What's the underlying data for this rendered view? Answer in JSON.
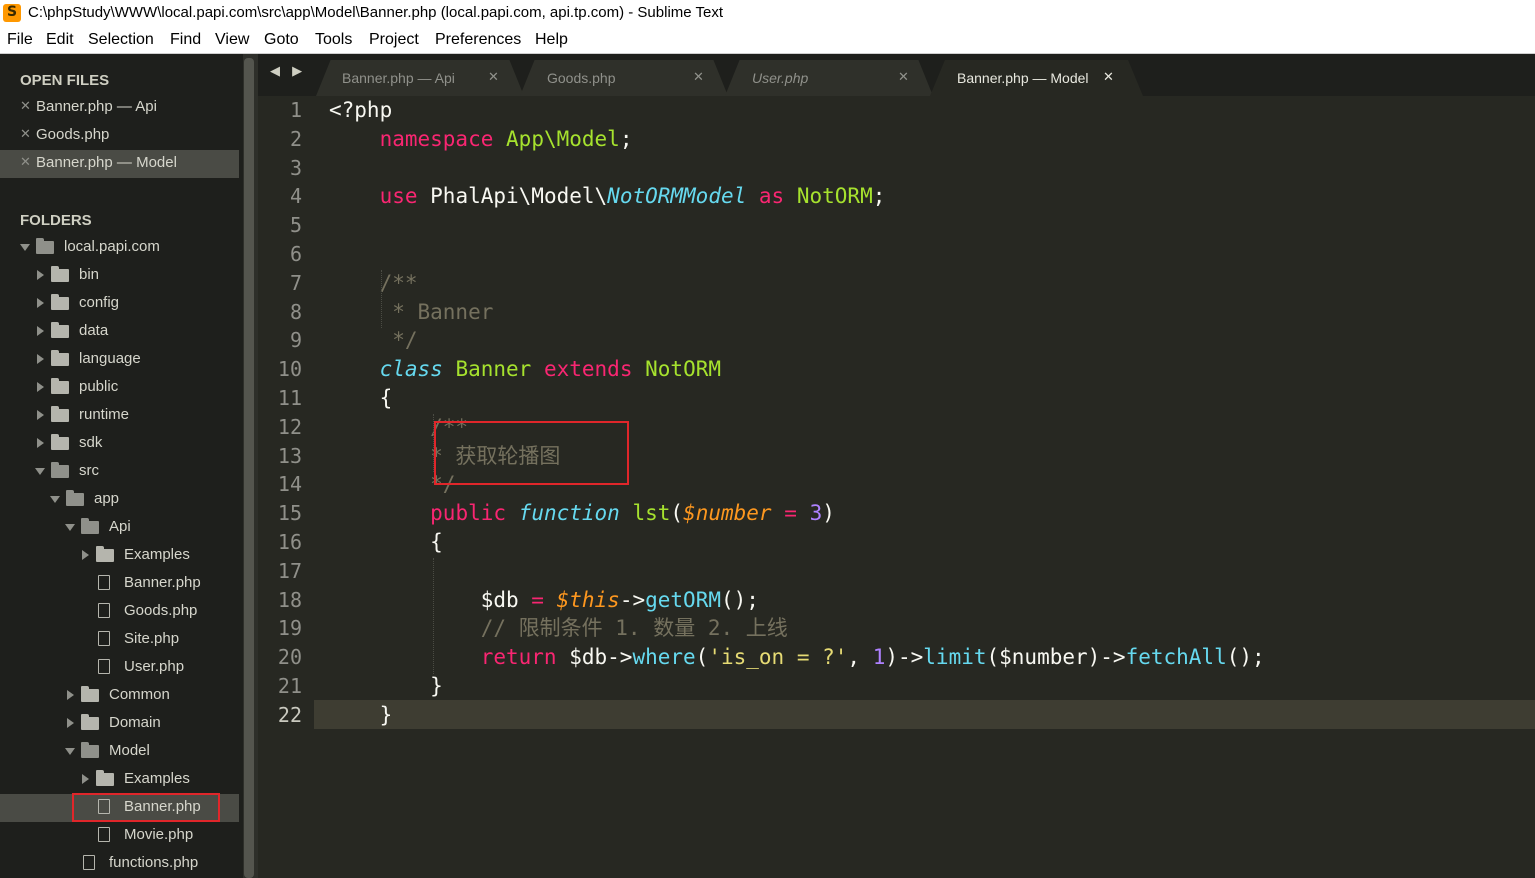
{
  "window": {
    "title": "C:\\phpStudy\\WWW\\local.papi.com\\src\\app\\Model\\Banner.php (local.papi.com, api.tp.com) - Sublime Text",
    "icon": "sublime-text-icon"
  },
  "menu": [
    "File",
    "Edit",
    "Selection",
    "Find",
    "View",
    "Goto",
    "Tools",
    "Project",
    "Preferences",
    "Help"
  ],
  "sidebar": {
    "open_files_title": "OPEN FILES",
    "open_files": [
      {
        "label": "Banner.php — Api",
        "active": false
      },
      {
        "label": "Goods.php",
        "active": false
      },
      {
        "label": "Banner.php — Model",
        "active": true
      }
    ],
    "folders_title": "FOLDERS",
    "tree": [
      {
        "label": "local.papi.com",
        "kind": "folder",
        "expanded": true,
        "depth": 0
      },
      {
        "label": "bin",
        "kind": "folder",
        "expanded": false,
        "depth": 1
      },
      {
        "label": "config",
        "kind": "folder",
        "expanded": false,
        "depth": 1
      },
      {
        "label": "data",
        "kind": "folder",
        "expanded": false,
        "depth": 1
      },
      {
        "label": "language",
        "kind": "folder",
        "expanded": false,
        "depth": 1
      },
      {
        "label": "public",
        "kind": "folder",
        "expanded": false,
        "depth": 1
      },
      {
        "label": "runtime",
        "kind": "folder",
        "expanded": false,
        "depth": 1
      },
      {
        "label": "sdk",
        "kind": "folder",
        "expanded": false,
        "depth": 1
      },
      {
        "label": "src",
        "kind": "folder",
        "expanded": true,
        "depth": 1
      },
      {
        "label": "app",
        "kind": "folder",
        "expanded": true,
        "depth": 2
      },
      {
        "label": "Api",
        "kind": "folder",
        "expanded": true,
        "depth": 3
      },
      {
        "label": "Examples",
        "kind": "folder",
        "expanded": false,
        "depth": 4
      },
      {
        "label": "Banner.php",
        "kind": "file",
        "depth": 4
      },
      {
        "label": "Goods.php",
        "kind": "file",
        "depth": 4
      },
      {
        "label": "Site.php",
        "kind": "file",
        "depth": 4
      },
      {
        "label": "User.php",
        "kind": "file",
        "depth": 4
      },
      {
        "label": "Common",
        "kind": "folder",
        "expanded": false,
        "depth": 3
      },
      {
        "label": "Domain",
        "kind": "folder",
        "expanded": false,
        "depth": 3
      },
      {
        "label": "Model",
        "kind": "folder",
        "expanded": true,
        "depth": 3
      },
      {
        "label": "Examples",
        "kind": "folder",
        "expanded": false,
        "depth": 4
      },
      {
        "label": "Banner.php",
        "kind": "file",
        "depth": 4,
        "selected": true
      },
      {
        "label": "Movie.php",
        "kind": "file",
        "depth": 4
      },
      {
        "label": "functions.php",
        "kind": "file",
        "depth": 3
      }
    ]
  },
  "nav_arrows": "◀ ▶",
  "tabs": [
    {
      "label": "Banner.php — Api",
      "active": false,
      "italic": false
    },
    {
      "label": "Goods.php",
      "active": false,
      "italic": false
    },
    {
      "label": "User.php",
      "active": false,
      "italic": true
    },
    {
      "label": "Banner.php — Model",
      "active": true,
      "italic": false
    }
  ],
  "tab_close_glyph": "✕",
  "editor": {
    "current_line": 22,
    "lines": [
      [
        {
          "t": "<?php",
          "c": ""
        }
      ],
      [
        {
          "t": "    ",
          "c": ""
        },
        {
          "t": "namespace",
          "c": "kw"
        },
        {
          "t": " ",
          "c": ""
        },
        {
          "t": "App\\Model",
          "c": "ty"
        },
        {
          "t": ";",
          "c": ""
        }
      ],
      [],
      [
        {
          "t": "    ",
          "c": ""
        },
        {
          "t": "use",
          "c": "kw"
        },
        {
          "t": " PhalApi\\Model\\",
          "c": ""
        },
        {
          "t": "NotORMModel",
          "c": "st"
        },
        {
          "t": " ",
          "c": ""
        },
        {
          "t": "as",
          "c": "kw"
        },
        {
          "t": " ",
          "c": ""
        },
        {
          "t": "NotORM",
          "c": "ty"
        },
        {
          "t": ";",
          "c": ""
        }
      ],
      [],
      [],
      [
        {
          "t": "    /**",
          "c": "cm"
        }
      ],
      [
        {
          "t": "     * Banner",
          "c": "cm"
        }
      ],
      [
        {
          "t": "     */",
          "c": "cm"
        }
      ],
      [
        {
          "t": "    ",
          "c": ""
        },
        {
          "t": "class",
          "c": "st"
        },
        {
          "t": " ",
          "c": ""
        },
        {
          "t": "Banner",
          "c": "ty"
        },
        {
          "t": " ",
          "c": ""
        },
        {
          "t": "extends",
          "c": "kw"
        },
        {
          "t": " ",
          "c": ""
        },
        {
          "t": "NotORM",
          "c": "ty"
        }
      ],
      [
        {
          "t": "    {",
          "c": ""
        }
      ],
      [
        {
          "t": "        /**",
          "c": "cm"
        }
      ],
      [
        {
          "t": "        * 获取轮播图",
          "c": "cm"
        }
      ],
      [
        {
          "t": "        */",
          "c": "cm"
        }
      ],
      [
        {
          "t": "        ",
          "c": ""
        },
        {
          "t": "public",
          "c": "kw"
        },
        {
          "t": " ",
          "c": ""
        },
        {
          "t": "function",
          "c": "st"
        },
        {
          "t": " ",
          "c": ""
        },
        {
          "t": "lst",
          "c": "ty"
        },
        {
          "t": "(",
          "c": ""
        },
        {
          "t": "$number",
          "c": "var"
        },
        {
          "t": " ",
          "c": ""
        },
        {
          "t": "=",
          "c": "kw"
        },
        {
          "t": " ",
          "c": ""
        },
        {
          "t": "3",
          "c": "num"
        },
        {
          "t": ")",
          "c": ""
        }
      ],
      [
        {
          "t": "        {",
          "c": ""
        }
      ],
      [],
      [
        {
          "t": "            $db ",
          "c": ""
        },
        {
          "t": "=",
          "c": "kw"
        },
        {
          "t": " ",
          "c": ""
        },
        {
          "t": "$this",
          "c": "var"
        },
        {
          "t": "->",
          "c": ""
        },
        {
          "t": "getORM",
          "c": "fn"
        },
        {
          "t": "();",
          "c": ""
        }
      ],
      [
        {
          "t": "            // 限制条件 1. 数量 2. 上线",
          "c": "cm"
        }
      ],
      [
        {
          "t": "            ",
          "c": ""
        },
        {
          "t": "return",
          "c": "kw"
        },
        {
          "t": " $db->",
          "c": ""
        },
        {
          "t": "where",
          "c": "fn"
        },
        {
          "t": "(",
          "c": ""
        },
        {
          "t": "'is_on = ?'",
          "c": "str"
        },
        {
          "t": ", ",
          "c": ""
        },
        {
          "t": "1",
          "c": "num"
        },
        {
          "t": ")->",
          "c": ""
        },
        {
          "t": "limit",
          "c": "fn"
        },
        {
          "t": "($number)->",
          "c": ""
        },
        {
          "t": "fetchAll",
          "c": "fn"
        },
        {
          "t": "();",
          "c": ""
        }
      ],
      [
        {
          "t": "        }",
          "c": ""
        }
      ],
      [
        {
          "t": "    }",
          "c": ""
        }
      ]
    ]
  }
}
